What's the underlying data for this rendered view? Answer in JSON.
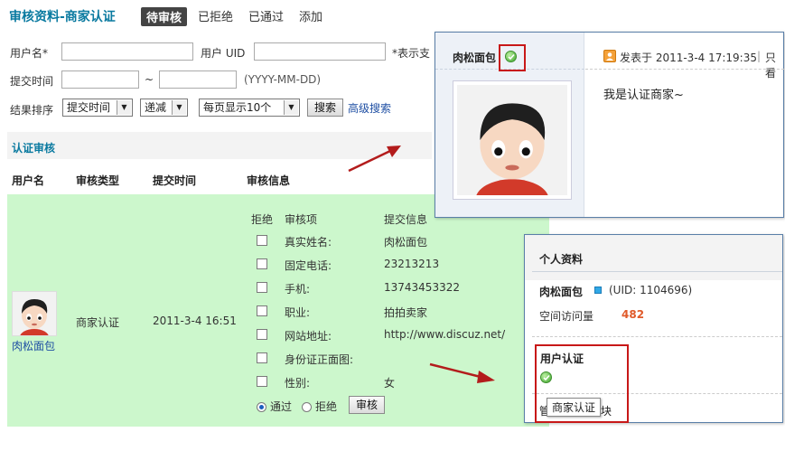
{
  "header": {
    "title": "审核资料-商家认证",
    "tabs": [
      {
        "label": "待审核",
        "active": true
      },
      {
        "label": "已拒绝",
        "active": false
      },
      {
        "label": "已通过",
        "active": false
      },
      {
        "label": "添加",
        "active": false
      }
    ]
  },
  "filters": {
    "username_label": "用户名*",
    "uid_label": "用户 UID",
    "required_note": "*表示支",
    "time_label": "提交时间",
    "time_sep": "~",
    "date_hint": "(YYYY-MM-DD)",
    "sort_label": "结果排序",
    "sort_field": "提交时间",
    "sort_order": "递减",
    "per_page": "每页显示10个",
    "search_button": "搜索",
    "advanced_link": "高级搜索"
  },
  "section": {
    "title": "认证审核",
    "columns": [
      "用户名",
      "审核类型",
      "提交时间",
      "审核信息"
    ]
  },
  "record": {
    "username": "肉松面包",
    "type": "商家认证",
    "time": "2011-3-4 16:51",
    "sub_headers": {
      "reject": "拒绝",
      "item": "审核项",
      "info": "提交信息"
    },
    "items": [
      {
        "label": "真实姓名:",
        "value": "肉松面包"
      },
      {
        "label": "固定电话:",
        "value": "23213213"
      },
      {
        "label": "手机:",
        "value": "13743453322"
      },
      {
        "label": "职业:",
        "value": "拍拍卖家"
      },
      {
        "label": "网站地址:",
        "value": "http://www.discuz.net/"
      },
      {
        "label": "身份证正面图:",
        "value": ""
      },
      {
        "label": "性别:",
        "value": "女"
      }
    ],
    "pass_label": "通过",
    "reject_label": "拒绝",
    "submit_button": "审核"
  },
  "post_panel": {
    "author": "肉松面包",
    "posted": "发表于 2011-3-4 17:19:35",
    "only": "只看",
    "separator": "|",
    "message": "我是认证商家~"
  },
  "profile_panel": {
    "title": "个人资料",
    "name": "肉松面包",
    "uid": "(UID: 1104696)",
    "visits_label": "空间访问量",
    "visits": "482",
    "cert_title": "用户认证",
    "tooltip": "商家认证",
    "cut_text_left": "管",
    "cut_text_right": "块"
  },
  "colors": {
    "accent": "#0a7aa0",
    "highlight": "#ccf7cc",
    "annotation": "#c81818",
    "visits": "#e05a2a"
  }
}
